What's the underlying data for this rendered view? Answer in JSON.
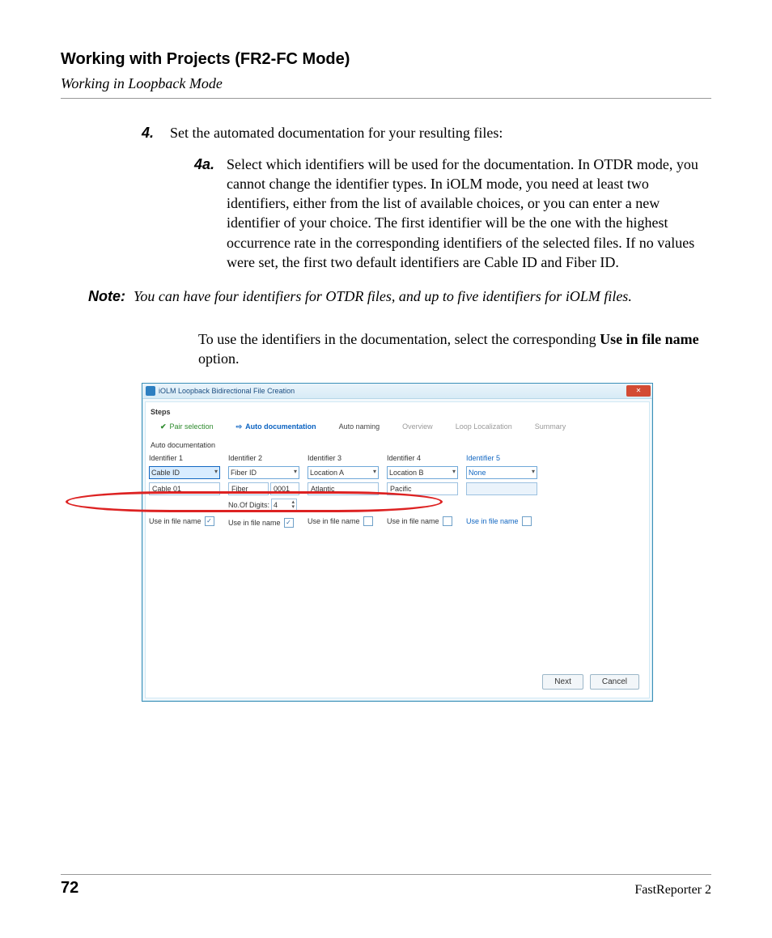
{
  "header": {
    "chapter": "Working with Projects (FR2-FC Mode)",
    "section": "Working in Loopback Mode"
  },
  "step4": {
    "num": "4.",
    "text": "Set the automated documentation for your resulting files:",
    "sub": {
      "num": "4a.",
      "text": "Select which identifiers will be used for the documentation. In OTDR mode, you cannot change the identifier types. In iOLM mode, you need at least two identifiers, either from the list of available choices, or you can enter a new identifier of your choice. The first identifier will be the one with the highest occurrence rate in the corresponding identifiers of the selected files. If no values were set, the first two default identifiers are Cable ID and Fiber ID."
    }
  },
  "note": {
    "label": "Note:",
    "text": "You can have four identifiers for OTDR files, and up to five identifiers for iOLM files."
  },
  "para": {
    "pre": "To use the identifiers in the documentation, select the corresponding ",
    "bold": "Use in file name",
    "post": " option."
  },
  "dialog": {
    "title": "iOLM Loopback Bidirectional File Creation",
    "close": "✕",
    "steps_label": "Steps",
    "tabs": {
      "pair": "Pair selection",
      "auto_doc": "Auto documentation",
      "auto_naming": "Auto naming",
      "overview": "Overview",
      "loop": "Loop Localization",
      "summary": "Summary"
    },
    "section_label": "Auto documentation",
    "identifiers": [
      {
        "label": "Identifier 1",
        "combo": "Cable ID",
        "value": "Cable 01",
        "cb_label": "Use in file name",
        "checked": true,
        "selected": true
      },
      {
        "label": "Identifier 2",
        "combo": "Fiber ID",
        "value": "Fiber",
        "value2": "0001",
        "digits_label": "No.Of Digits:",
        "digits": "4",
        "cb_label": "Use in file name",
        "checked": true
      },
      {
        "label": "Identifier 3",
        "combo": "Location A",
        "value": "Atlantic",
        "cb_label": "Use in file name",
        "checked": false
      },
      {
        "label": "Identifier 4",
        "combo": "Location B",
        "value": "Pacific",
        "cb_label": "Use in file name",
        "checked": false
      },
      {
        "label": "Identifier 5",
        "combo": "None",
        "value": "",
        "cb_label": "Use in file name",
        "checked": false
      }
    ],
    "buttons": {
      "next": "Next",
      "cancel": "Cancel"
    }
  },
  "footer": {
    "page": "72",
    "product": "FastReporter 2"
  }
}
